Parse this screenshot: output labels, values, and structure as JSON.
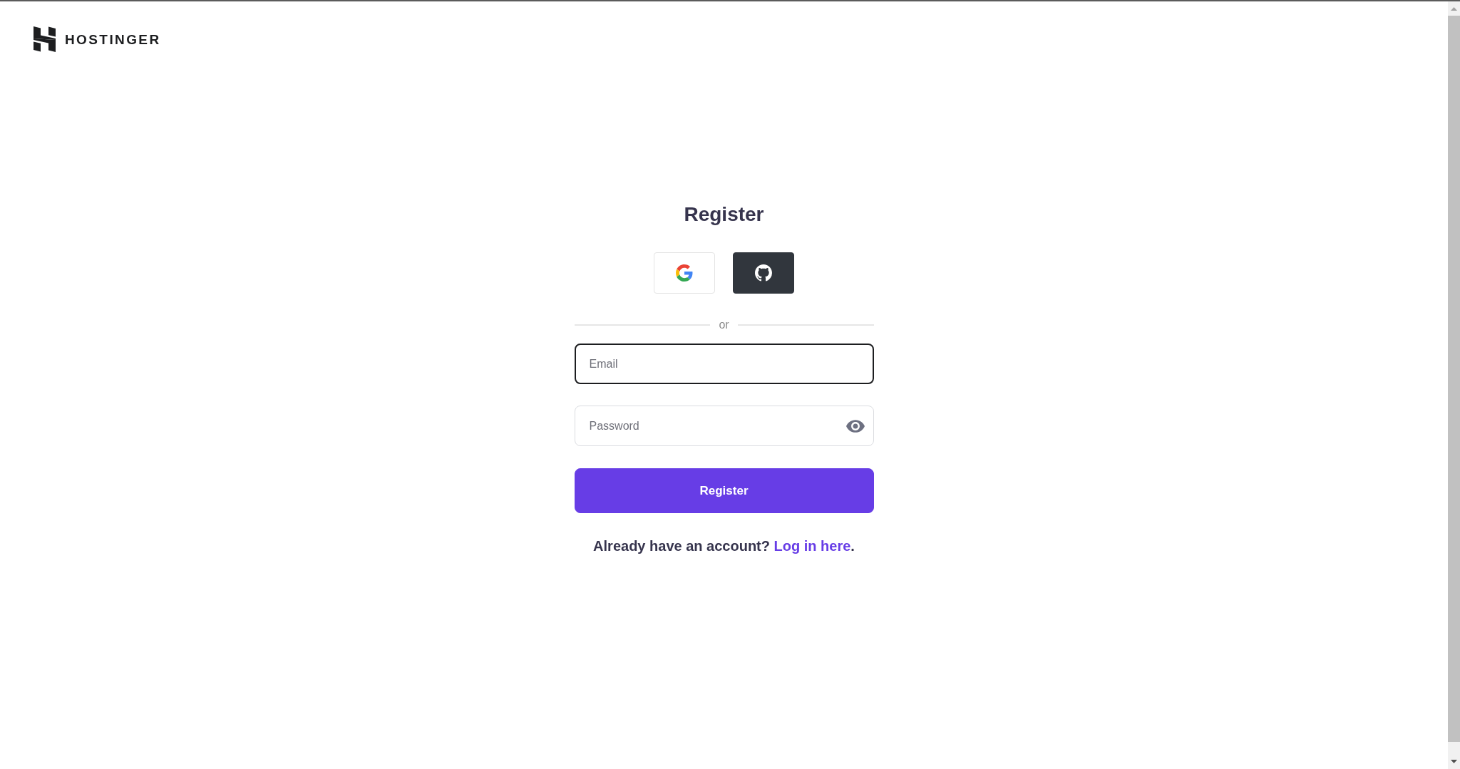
{
  "brand": {
    "name": "HOSTINGER"
  },
  "title": "Register",
  "social_buttons": [
    {
      "kind": "google"
    },
    {
      "kind": "github"
    }
  ],
  "divider": {
    "text": "or"
  },
  "fields": [
    {
      "kind": "email",
      "placeholder": "Email",
      "focused": true
    },
    {
      "kind": "password",
      "placeholder": "Password",
      "focused": false
    }
  ],
  "submit_button": {
    "label": "Register"
  },
  "login_prompt": {
    "text": "Already have an account?",
    "link": "Log in here",
    "end": "."
  }
}
